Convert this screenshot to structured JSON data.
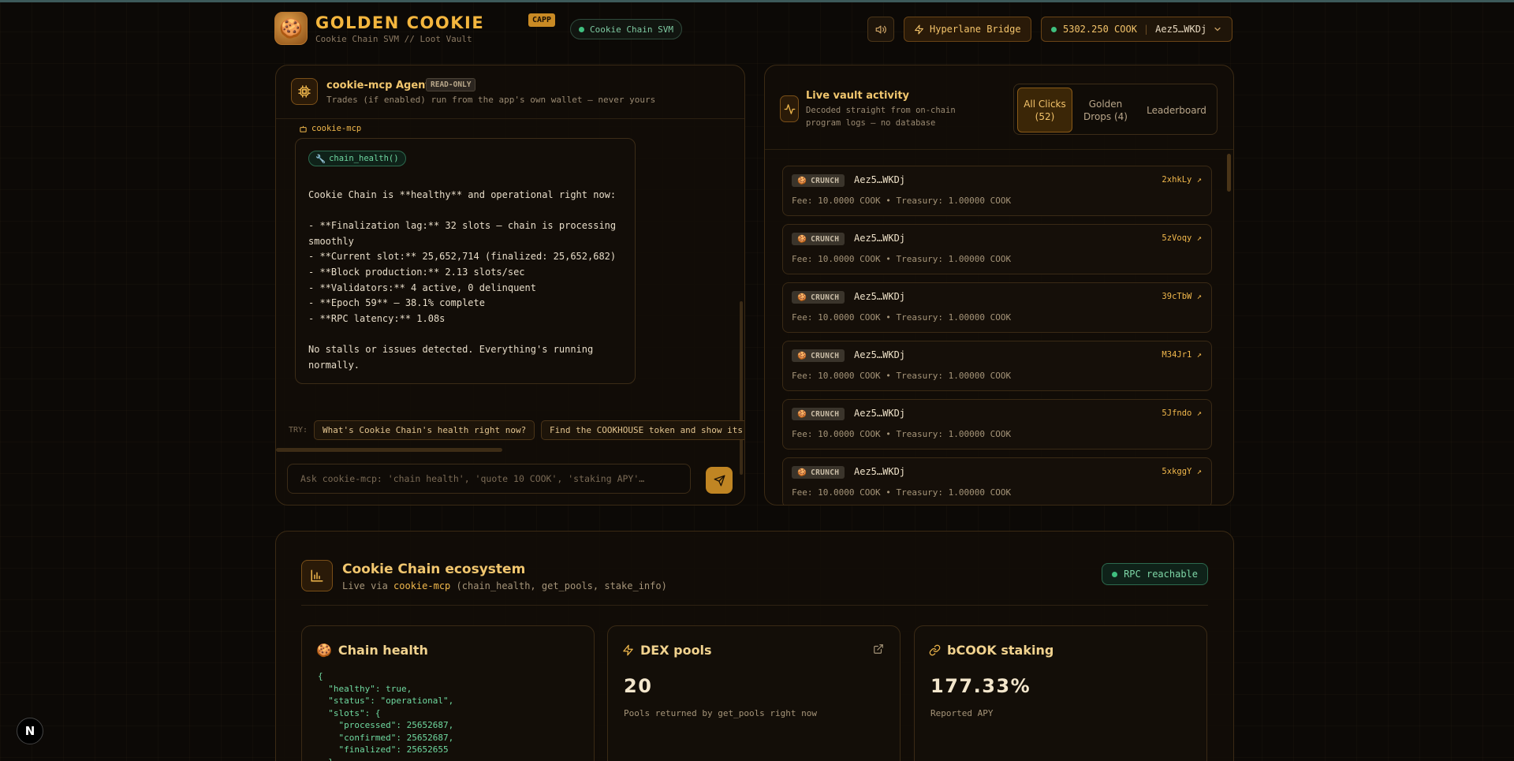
{
  "header": {
    "brand": "GOLDEN COOKIE",
    "badge": "CAPP",
    "subtitle": "Cookie Chain SVM // Loot Vault",
    "chain_pill": "Cookie Chain SVM",
    "bridge_label": "Hyperlane Bridge",
    "wallet_balance": "5302.250 COOK",
    "wallet_address": "Aez5…WKDj",
    "icons": {
      "logo": "cookie-icon",
      "sound": "speaker-icon",
      "bridge": "lightning-icon",
      "wallet_caret": "chevron-down-icon"
    }
  },
  "agent": {
    "title": "cookie-mcp Agent",
    "badge": "READ-ONLY",
    "subtitle": "Trades (if enabled) run from the app's own wallet — never yours",
    "sender": "cookie-mcp",
    "tool_call": "chain_health()",
    "message": "Cookie Chain is **healthy** and operational right now:\n\n- **Finalization lag:** 32 slots — chain is processing smoothly\n- **Current slot:** 25,652,714 (finalized: 25,652,682)\n- **Block production:** 2.13 slots/sec\n- **Validators:** 4 active, 0 delinquent\n- **Epoch 59** — 38.1% complete\n- **RPC latency:** 1.08s\n\nNo stalls or issues detected. Everything's running normally.",
    "try_label": "TRY:",
    "suggestions": [
      "What's Cookie Chain's health right now?",
      "Find the COOKHOUSE token and show its"
    ],
    "input_placeholder": "Ask cookie-mcp: 'chain health', 'quote 10 COOK', 'staking APY'…"
  },
  "activity": {
    "title": "Live vault activity",
    "subtitle": "Decoded straight from on-chain program logs — no database",
    "tabs": [
      {
        "label": "All Clicks (52)",
        "active": true
      },
      {
        "label": "Golden Drops (4)",
        "active": false
      },
      {
        "label": "Leaderboard",
        "active": false
      }
    ],
    "items": [
      {
        "type": "CRUNCH",
        "address": "Aez5…WKDj",
        "tx": "2xhkLy ↗",
        "fee": "Fee: 10.0000 COOK • Treasury: 1.00000 COOK"
      },
      {
        "type": "CRUNCH",
        "address": "Aez5…WKDj",
        "tx": "5zVoqy ↗",
        "fee": "Fee: 10.0000 COOK • Treasury: 1.00000 COOK"
      },
      {
        "type": "CRUNCH",
        "address": "Aez5…WKDj",
        "tx": "39cTbW ↗",
        "fee": "Fee: 10.0000 COOK • Treasury: 1.00000 COOK"
      },
      {
        "type": "CRUNCH",
        "address": "Aez5…WKDj",
        "tx": "M34Jr1 ↗",
        "fee": "Fee: 10.0000 COOK • Treasury: 1.00000 COOK"
      },
      {
        "type": "CRUNCH",
        "address": "Aez5…WKDj",
        "tx": "5Jfndo ↗",
        "fee": "Fee: 10.0000 COOK • Treasury: 1.00000 COOK"
      },
      {
        "type": "CRUNCH",
        "address": "Aez5…WKDj",
        "tx": "5xkggY ↗",
        "fee": "Fee: 10.0000 COOK • Treasury: 1.00000 COOK"
      }
    ]
  },
  "ecosystem": {
    "title": "Cookie Chain ecosystem",
    "subtitle_prefix": "Live via",
    "subtitle_highlight": "cookie-mcp",
    "subtitle_suffix": "(chain_health, get_pools, stake_info)",
    "status": "RPC reachable",
    "cards": {
      "health": {
        "title": "Chain health",
        "json": "{\n  \"healthy\": true,\n  \"status\": \"operational\",\n  \"slots\": {\n    \"processed\": 25652687,\n    \"confirmed\": 25652687,\n    \"finalized\": 25652655\n  },"
      },
      "pools": {
        "title": "DEX pools",
        "value": "20",
        "note": "Pools returned by get_pools right now"
      },
      "staking": {
        "title": "bCOOK staking",
        "value": "177.33%",
        "note": "Reported APY"
      }
    }
  },
  "colors": {
    "accent": "#f1b84c",
    "accent_dark": "#c08523",
    "success": "#3fbf7f",
    "background": "#0c0906"
  }
}
